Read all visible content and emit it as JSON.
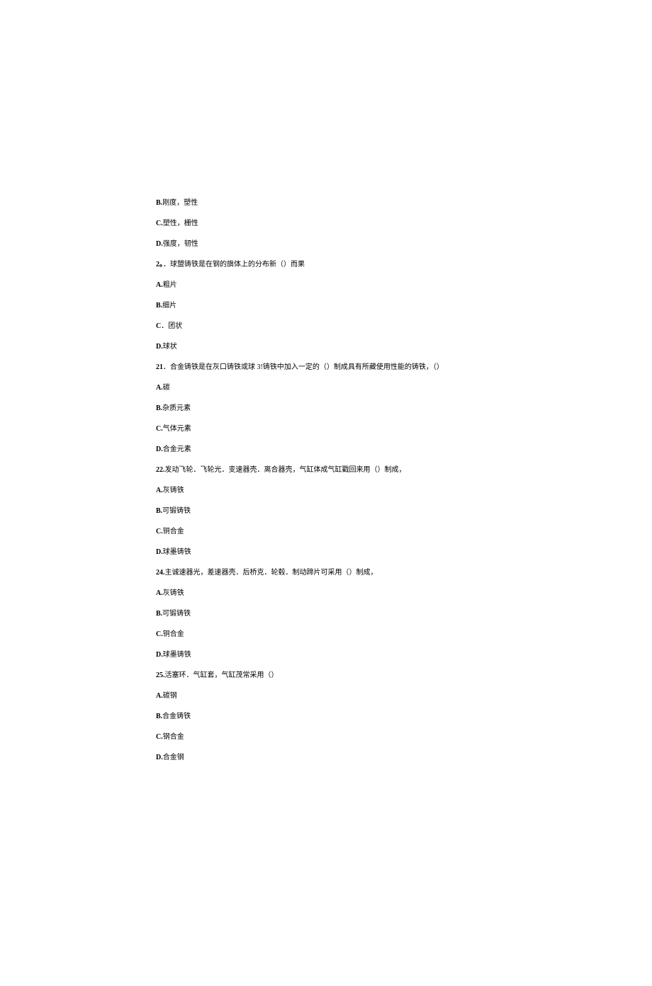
{
  "lines": [
    {
      "prefix": "B.",
      "text": "刚度，塑性"
    },
    {
      "prefix": "C.",
      "text": "塑性，栅性"
    },
    {
      "prefix": "D.",
      "text": "强度，韧性"
    },
    {
      "prefix": "2。",
      "text": "．球盟铸铁是在钢的旗体上的分布新（）而果"
    },
    {
      "prefix": "A.",
      "text": "粗片"
    },
    {
      "prefix": "B.",
      "text": "细片"
    },
    {
      "prefix": "C",
      "text": "．团状"
    },
    {
      "prefix": "D.",
      "text": "球状"
    },
    {
      "prefix": "21",
      "text": "．合金铸铁是在灰口铸铁或球 3!铸铁中加入一定的（）制成具有所藏使用性能的铸铁，（）"
    },
    {
      "prefix": "A.",
      "text": "碳"
    },
    {
      "prefix": "B.",
      "text": "杂质元素"
    },
    {
      "prefix": "C.",
      "text": "气体元素"
    },
    {
      "prefix": "D.",
      "text": "合金元素"
    },
    {
      "prefix": "22.",
      "text": "发动飞轮．飞轮光．变速器壳．离合器壳，气缸体成气缸戳回来用（）制成，"
    },
    {
      "prefix": "A.",
      "text": "灰铸铁"
    },
    {
      "prefix": "B.",
      "text": "可锻铸铁"
    },
    {
      "prefix": "C.",
      "text": "铜合金"
    },
    {
      "prefix": "D.",
      "text": "球墨铸铁"
    },
    {
      "prefix": "24.",
      "text": "主诚速器光，差速器壳．后桥克．轮毂．制动蹄片可采用（）制成，"
    },
    {
      "prefix": "A.",
      "text": "灰铸铁"
    },
    {
      "prefix": "B.",
      "text": "可锻铸铁"
    },
    {
      "prefix": "C.",
      "text": "铜合金"
    },
    {
      "prefix": "D.",
      "text": "球墨铸铁"
    },
    {
      "prefix": "25.",
      "text": "活塞环．气缸套，气缸茂常采用（）"
    },
    {
      "prefix": "A.",
      "text": "碳钢"
    },
    {
      "prefix": "B.",
      "text": "合金铸铁"
    },
    {
      "prefix": "C.",
      "text": "钢合金"
    },
    {
      "prefix": "D.",
      "text": "合金钢"
    }
  ]
}
